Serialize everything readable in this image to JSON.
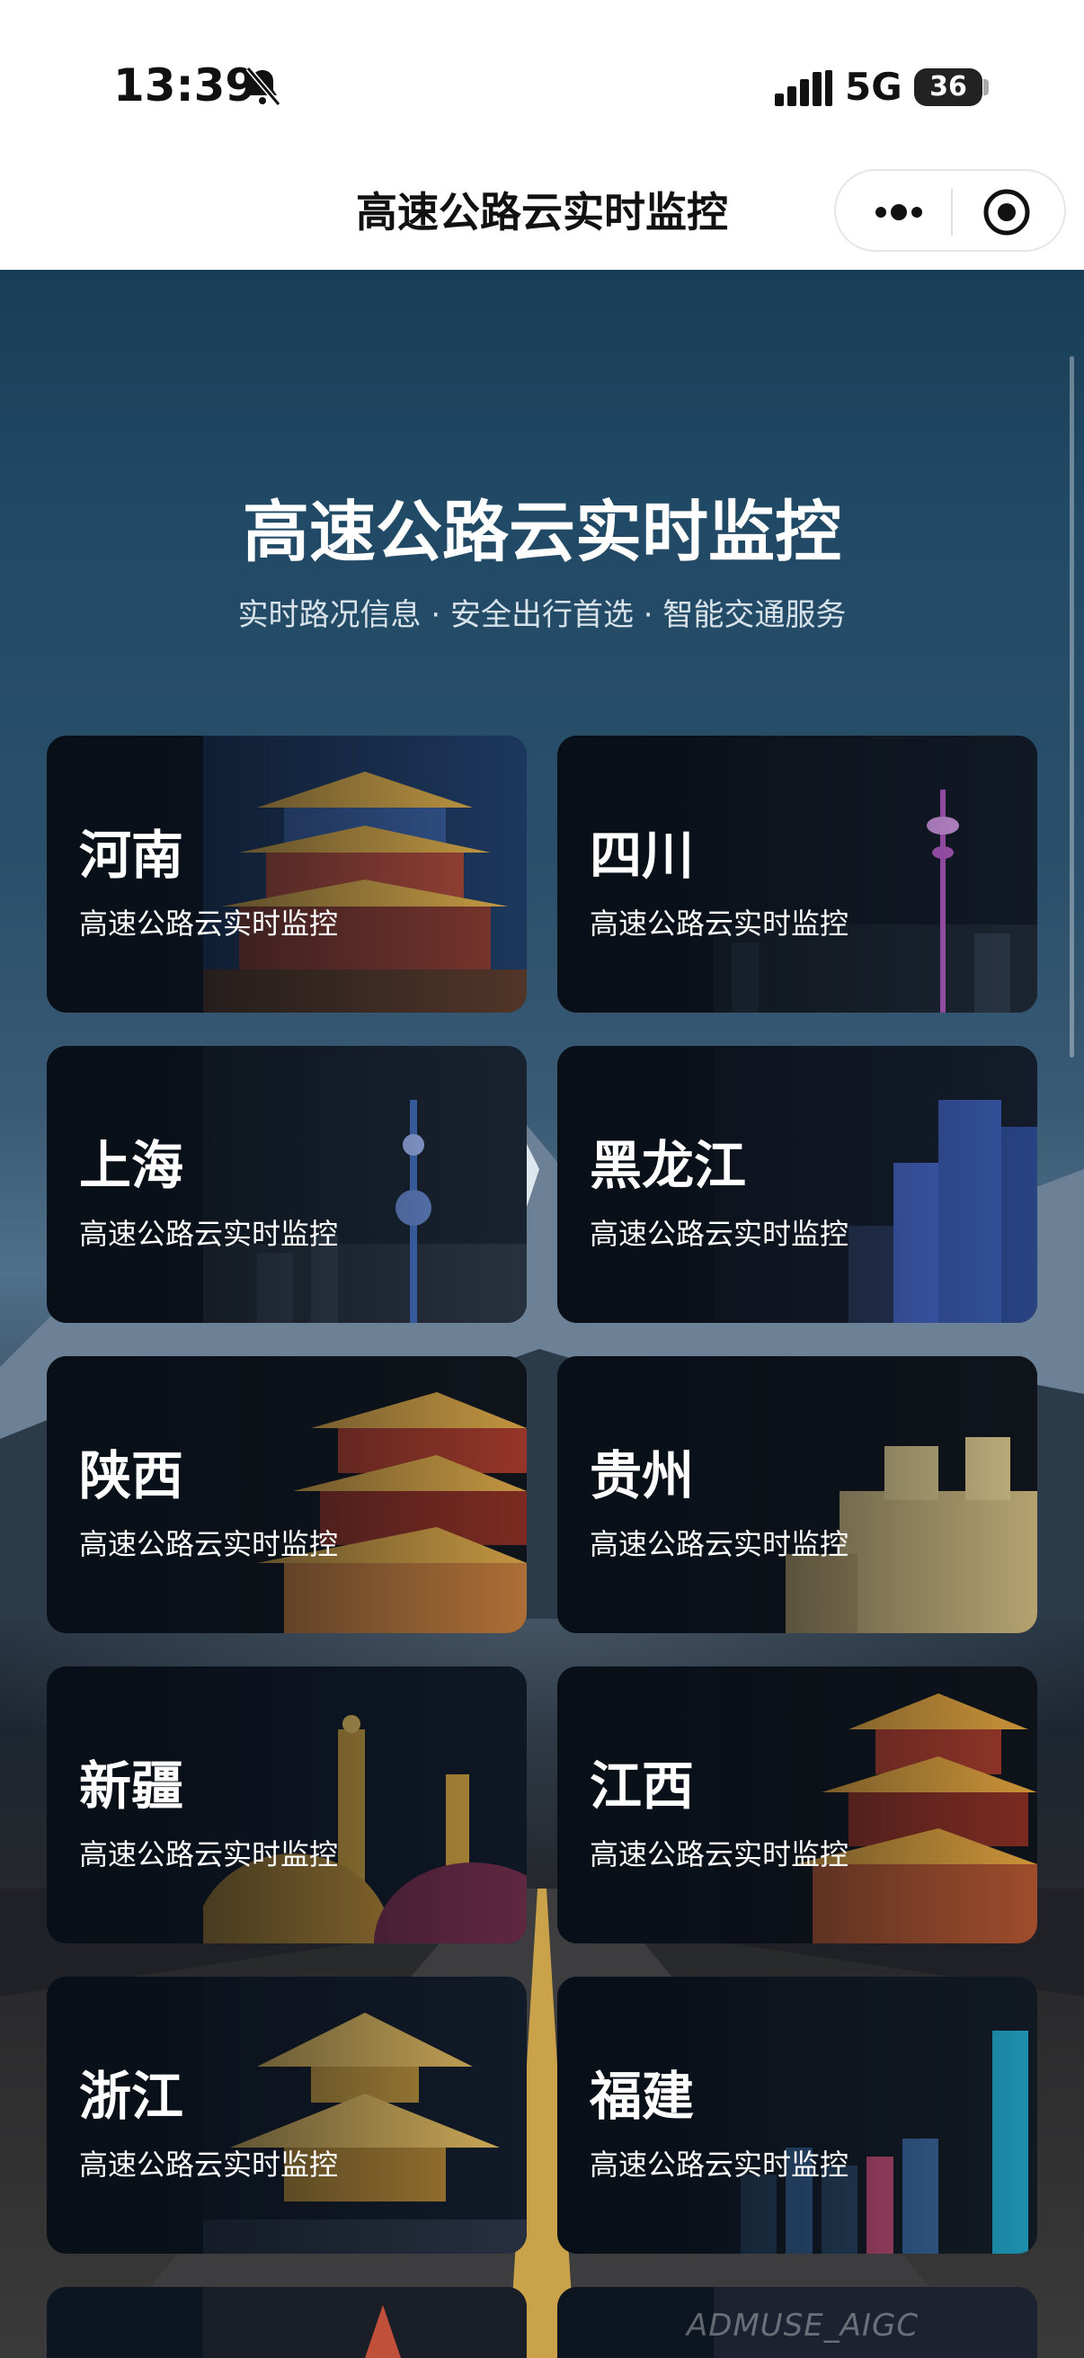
{
  "status_bar": {
    "time": "13:39",
    "network": "5G",
    "battery": "36"
  },
  "nav": {
    "title": "高速公路云实时监控"
  },
  "hero": {
    "title": "高速公路云实时监控",
    "subtitle": "实时路况信息 · 安全出行首选 · 智能交通服务"
  },
  "cards": [
    {
      "name": "河南",
      "subtitle": "高速公路云实时监控"
    },
    {
      "name": "四川",
      "subtitle": "高速公路云实时监控"
    },
    {
      "name": "上海",
      "subtitle": "高速公路云实时监控"
    },
    {
      "name": "黑龙江",
      "subtitle": "高速公路云实时监控"
    },
    {
      "name": "陕西",
      "subtitle": "高速公路云实时监控"
    },
    {
      "name": "贵州",
      "subtitle": "高速公路云实时监控"
    },
    {
      "name": "新疆",
      "subtitle": "高速公路云实时监控"
    },
    {
      "name": "江西",
      "subtitle": "高速公路云实时监控"
    },
    {
      "name": "浙江",
      "subtitle": "高速公路云实时监控"
    },
    {
      "name": "福建",
      "subtitle": "高速公路云实时监控"
    }
  ],
  "watermark": "ADMUSE_AIGC",
  "colors": {
    "accent_gold": "#e9b84a",
    "card_bg": "#0d1620"
  }
}
